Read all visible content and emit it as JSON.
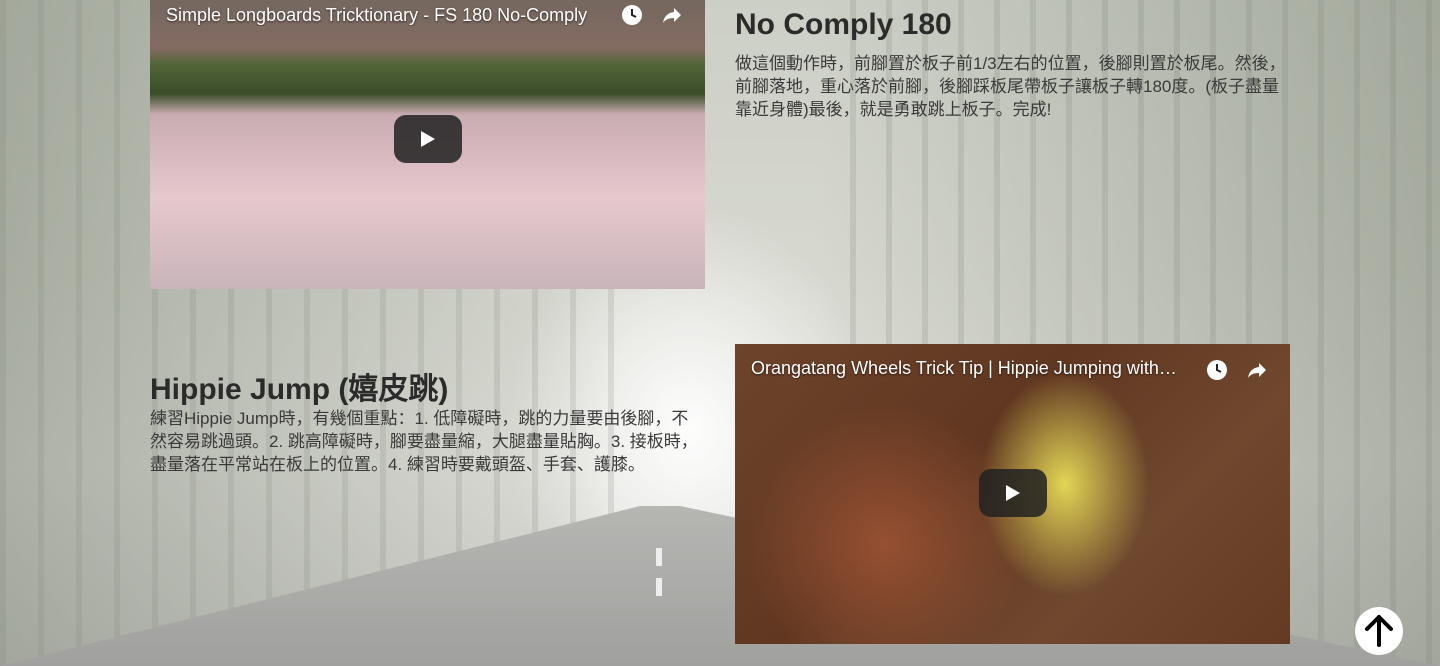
{
  "videos": [
    {
      "title": "Simple Longboards Tricktionary - FS 180 No-Comply",
      "icons": [
        "clock-icon",
        "share-icon",
        "play-icon"
      ]
    },
    {
      "title": "Orangatang Wheels Trick Tip | Hippie Jumping with Ca...",
      "icons": [
        "clock-icon",
        "share-icon",
        "play-icon"
      ]
    }
  ],
  "sections": [
    {
      "title": "No Comply 180",
      "text": "做這個動作時，前腳置於板子前1/3左右的位置，後腳則置於板尾。然後，前腳落地，重心落於前腳，後腳踩板尾帶板子讓板子轉180度。(板子盡量靠近身體)最後，就是勇敢跳上板子。完成!"
    },
    {
      "title": "Hippie Jump (嬉皮跳)",
      "text": "練習Hippie Jump時，有幾個重點：1. 低障礙時，跳的力量要由後腳，不然容易跳過頭。2. 跳高障礙時，腳要盡量縮，大腿盡量貼胸。3. 接板時，盡量落在平常站在板上的位置。4. 練習時要戴頭盔、手套、護膝。"
    }
  ],
  "scroll_top": {
    "icon": "arrow-up-icon"
  },
  "colors": {
    "play_button": "#212121",
    "title_text": "#2b2b2b",
    "body_text": "#3a3a3a"
  }
}
